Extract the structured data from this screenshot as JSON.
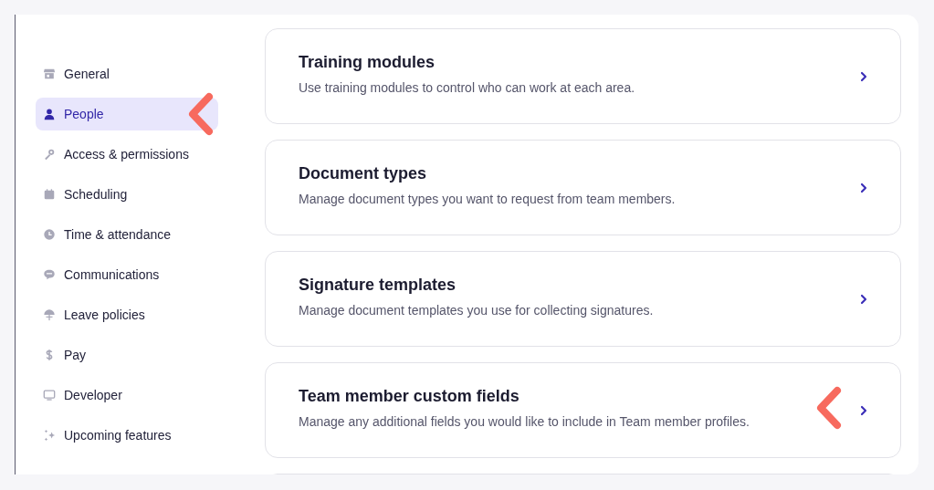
{
  "sidebar": {
    "items": [
      {
        "label": "General",
        "selected": false,
        "pointer": false
      },
      {
        "label": "People",
        "selected": true,
        "pointer": true
      },
      {
        "label": "Access & permissions",
        "selected": false,
        "pointer": false
      },
      {
        "label": "Scheduling",
        "selected": false,
        "pointer": false
      },
      {
        "label": "Time & attendance",
        "selected": false,
        "pointer": false
      },
      {
        "label": "Communications",
        "selected": false,
        "pointer": false
      },
      {
        "label": "Leave policies",
        "selected": false,
        "pointer": false
      },
      {
        "label": "Pay",
        "selected": false,
        "pointer": false
      },
      {
        "label": "Developer",
        "selected": false,
        "pointer": false
      },
      {
        "label": "Upcoming features",
        "selected": false,
        "pointer": false
      }
    ]
  },
  "cards": [
    {
      "title": "Training modules",
      "description": "Use training modules to control who can work at each area.",
      "pointer": false
    },
    {
      "title": "Document types",
      "description": "Manage document types you want to request from team members.",
      "pointer": false
    },
    {
      "title": "Signature templates",
      "description": "Manage document templates you use for collecting signatures.",
      "pointer": false
    },
    {
      "title": "Team member custom fields",
      "description": "Manage any additional fields you would like to include in Team member profiles.",
      "pointer": true
    }
  ]
}
